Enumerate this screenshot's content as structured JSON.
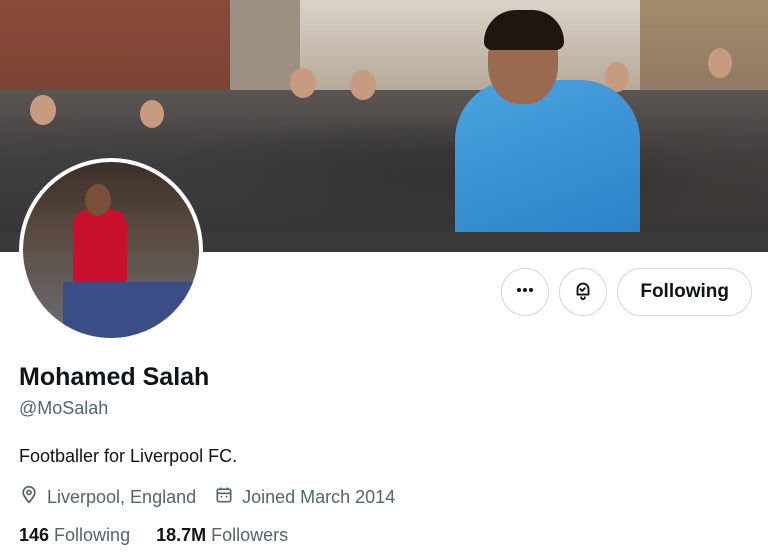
{
  "profile": {
    "name": "Mohamed Salah",
    "handle": "@MoSalah",
    "bio": "Footballer for Liverpool FC.",
    "location": "Liverpool, England",
    "joined": "Joined March 2014",
    "following_count": "146",
    "following_label": "Following",
    "followers_count": "18.7M",
    "followers_label": "Followers"
  },
  "actions": {
    "more_icon": "more-icon",
    "notify_icon": "bell-icon",
    "follow_label": "Following"
  },
  "icons": {
    "location": "location-pin-icon",
    "calendar": "calendar-icon"
  },
  "colors": {
    "text_primary": "#0f1419",
    "text_secondary": "#536471",
    "border": "#cfd9de"
  }
}
